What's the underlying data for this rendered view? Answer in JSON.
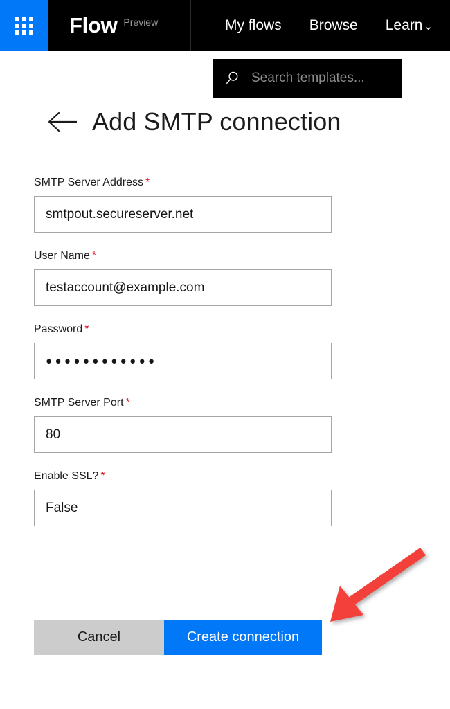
{
  "header": {
    "waffle_icon": "app-launcher-waffle-icon",
    "brand_name": "Flow",
    "brand_badge": "Preview",
    "nav_items": [
      {
        "label": "My flows",
        "has_chevron": false
      },
      {
        "label": "Browse",
        "has_chevron": false
      },
      {
        "label": "Learn",
        "has_chevron": true,
        "chevron": "⌄"
      }
    ],
    "brand_blue": "#0078f7",
    "background": "#000000"
  },
  "search": {
    "icon": "search-icon",
    "placeholder": "Search templates...",
    "value": ""
  },
  "page": {
    "back_icon": "back-arrow-icon",
    "back_glyph": "←",
    "title": "Add SMTP connection"
  },
  "form": {
    "required_marker": "*",
    "fields": [
      {
        "label": "SMTP Server Address",
        "required": true,
        "value": "smtpout.secureserver.net",
        "type": "text",
        "name": "smtp-server-address"
      },
      {
        "label": "User Name",
        "required": true,
        "value": "testaccount@example.com",
        "type": "text",
        "name": "user-name"
      },
      {
        "label": "Password",
        "required": true,
        "value": "●●●●●●●●●●●●",
        "type": "password",
        "name": "password"
      },
      {
        "label": "SMTP Server Port",
        "required": true,
        "value": "80",
        "type": "text",
        "name": "smtp-server-port"
      },
      {
        "label": "Enable SSL?",
        "required": true,
        "value": "False",
        "type": "text",
        "name": "enable-ssl"
      }
    ]
  },
  "actions": {
    "cancel_label": "Cancel",
    "create_label": "Create connection",
    "primary_color": "#0078f7",
    "cancel_color": "#cccccc"
  },
  "annotation": {
    "type": "arrow",
    "color": "#f4403a",
    "points_to": "Create connection"
  }
}
